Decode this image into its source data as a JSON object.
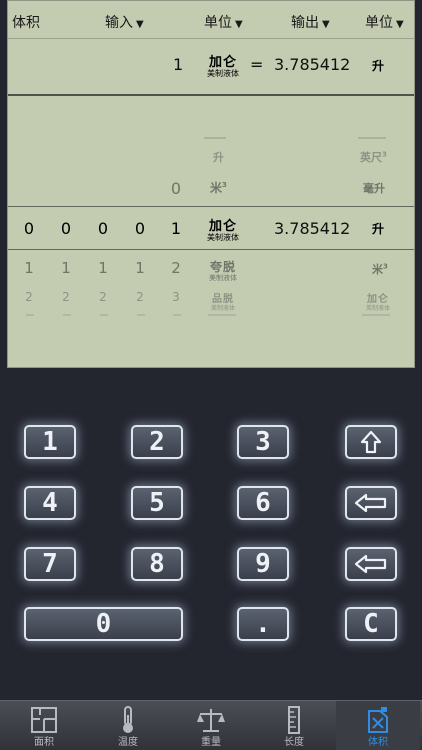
{
  "header": {
    "mode_label": "体积",
    "input_label": "输入",
    "unit_label": "单位",
    "output_label": "输出",
    "unit2_label": "单位"
  },
  "result": {
    "input_value": "1",
    "input_unit_main": "加仑",
    "input_unit_sub": "美制液体",
    "equals": "=",
    "output_value": "3.785412",
    "output_unit": "升"
  },
  "wheel": {
    "row_top1": {
      "unit_left": "升",
      "unit_right_main": "英尺",
      "unit_right_sup": "3"
    },
    "row_top2": {
      "digit": "0",
      "unit_left_main": "米",
      "unit_left_sup": "3",
      "unit_right": "毫升"
    },
    "row_sel": {
      "digits": [
        "0",
        "0",
        "0",
        "0",
        "1"
      ],
      "unit_main": "加仑",
      "unit_sub": "美制液体",
      "value": "3.785412",
      "unit_right": "升"
    },
    "row_b1": {
      "digits": [
        "1",
        "1",
        "1",
        "1",
        "2"
      ],
      "unit_main": "夸脱",
      "unit_sub": "美制液体",
      "unit_right_main": "米",
      "unit_right_sup": "3"
    },
    "row_b2": {
      "digits": [
        "2",
        "2",
        "2",
        "2",
        "3"
      ],
      "unit_main": "品脱",
      "unit_sub": "美制液体",
      "unit_right_main": "加仑",
      "unit_right_sub": "英制液体"
    }
  },
  "keypad": {
    "k1": "1",
    "k2": "2",
    "k3": "3",
    "k4": "4",
    "k5": "5",
    "k6": "6",
    "k7": "7",
    "k8": "8",
    "k9": "9",
    "k0": "0",
    "kdot": ".",
    "kc": "C",
    "shift_icon": "shift-up-arrow-icon",
    "left_icon": "left-arrow-icon",
    "backspace_icon": "backspace-arrow-icon"
  },
  "tabs": [
    {
      "label": "面积",
      "icon": "floor-plan-icon"
    },
    {
      "label": "温度",
      "icon": "thermometer-icon"
    },
    {
      "label": "重量",
      "icon": "balance-scale-icon"
    },
    {
      "label": "长度",
      "icon": "ruler-icon"
    },
    {
      "label": "体积",
      "icon": "jerrycan-icon",
      "active": true
    }
  ],
  "colors": {
    "background": "#23252f",
    "lcd": "#c3cbb1",
    "active_tab": "#2f8de6"
  }
}
